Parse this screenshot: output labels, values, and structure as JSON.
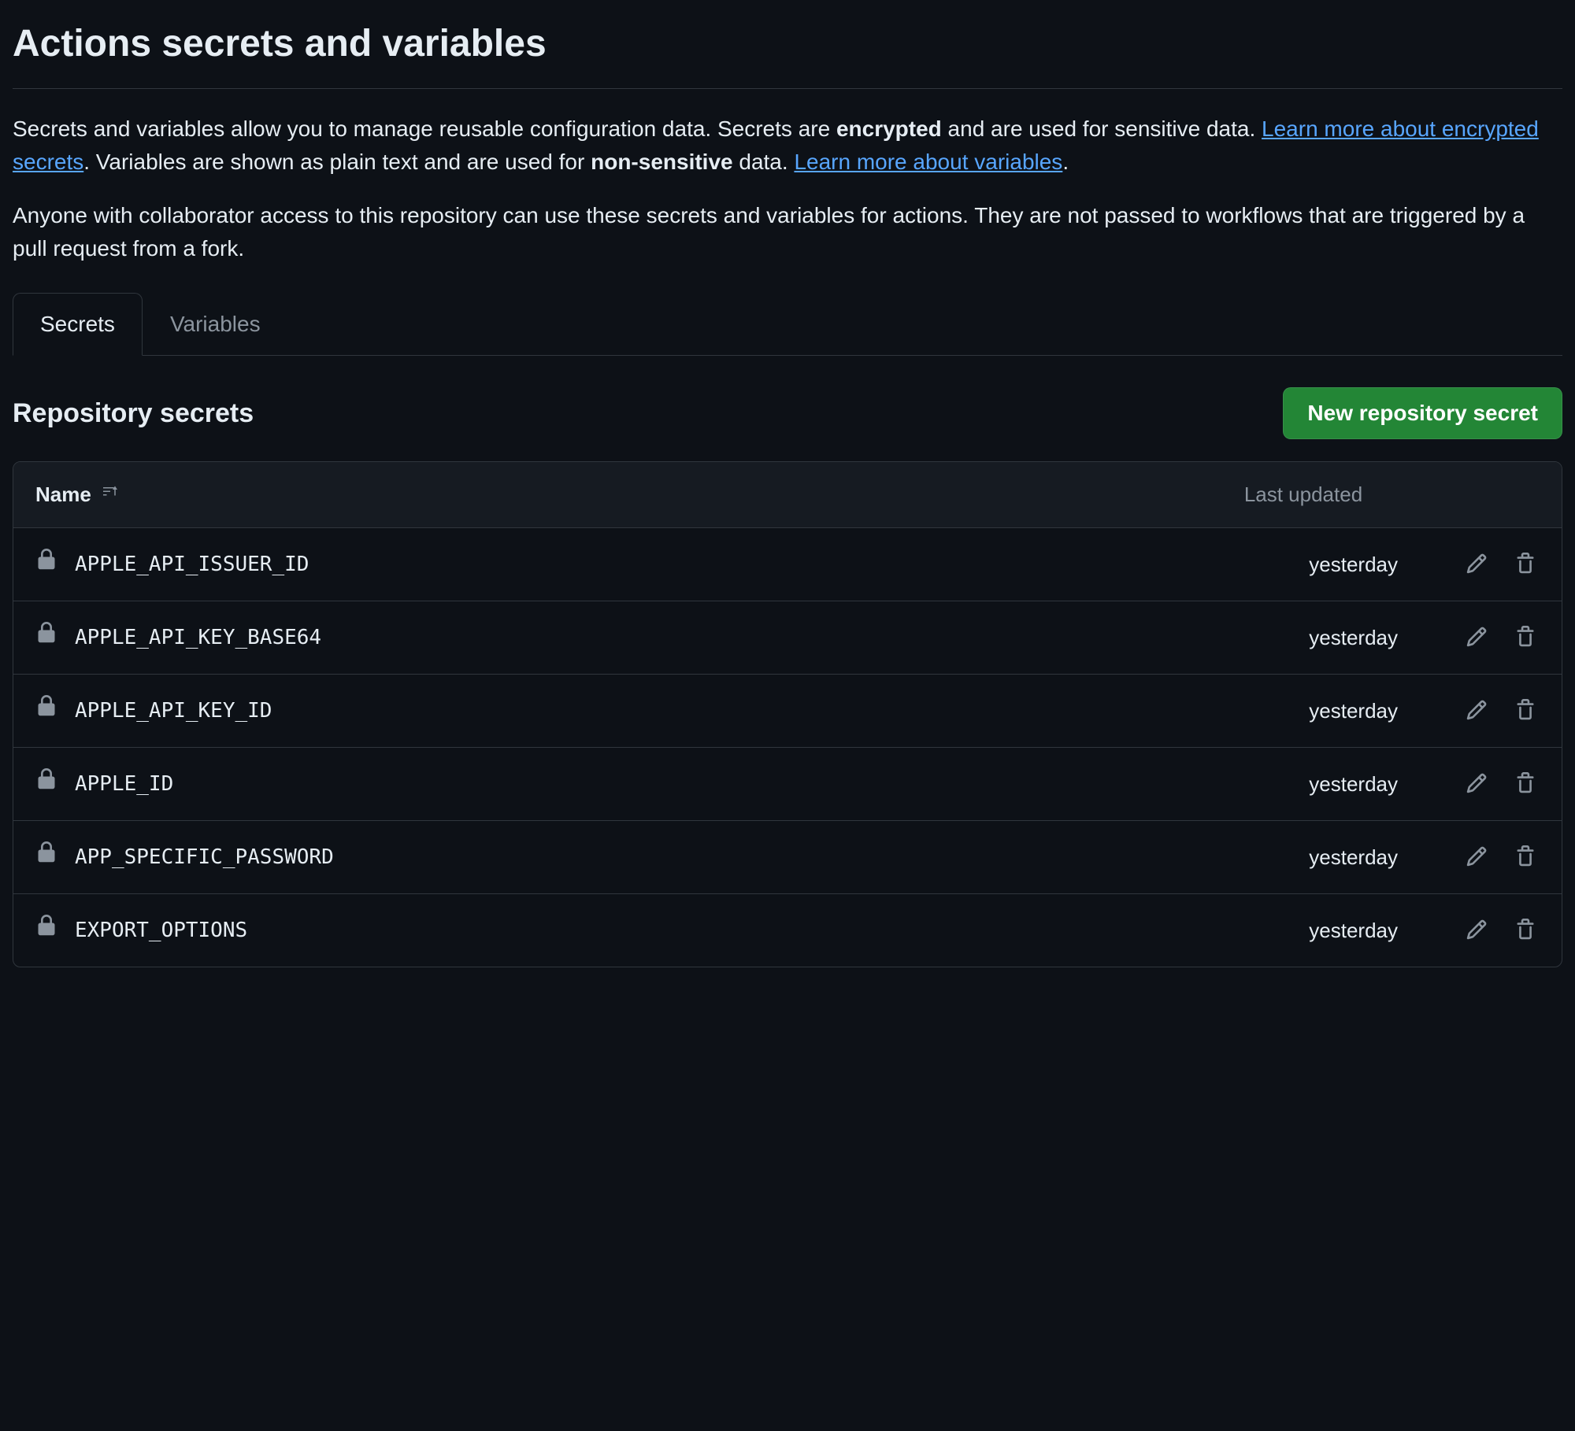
{
  "page": {
    "title": "Actions secrets and variables"
  },
  "intro": {
    "para1_a": "Secrets and variables allow you to manage reusable configuration data. Secrets are ",
    "para1_b": "encrypted",
    "para1_c": " and are used for sensitive data. ",
    "link1": "Learn more about encrypted secrets",
    "para1_d": ". Variables are shown as plain text and are used for ",
    "para1_e": "non-sensitive",
    "para1_f": " data. ",
    "link2": "Learn more about variables",
    "para1_g": ".",
    "para2": "Anyone with collaborator access to this repository can use these secrets and variables for actions. They are not passed to workflows that are triggered by a pull request from a fork."
  },
  "tabs": [
    {
      "label": "Secrets",
      "active": true
    },
    {
      "label": "Variables",
      "active": false
    }
  ],
  "section": {
    "title": "Repository secrets",
    "new_button": "New repository secret"
  },
  "table": {
    "columns": {
      "name": "Name",
      "updated": "Last updated"
    },
    "rows": [
      {
        "name": "APPLE_API_ISSUER_ID",
        "updated": "yesterday"
      },
      {
        "name": "APPLE_API_KEY_BASE64",
        "updated": "yesterday"
      },
      {
        "name": "APPLE_API_KEY_ID",
        "updated": "yesterday"
      },
      {
        "name": "APPLE_ID",
        "updated": "yesterday"
      },
      {
        "name": "APP_SPECIFIC_PASSWORD",
        "updated": "yesterday"
      },
      {
        "name": "EXPORT_OPTIONS",
        "updated": "yesterday"
      }
    ]
  }
}
